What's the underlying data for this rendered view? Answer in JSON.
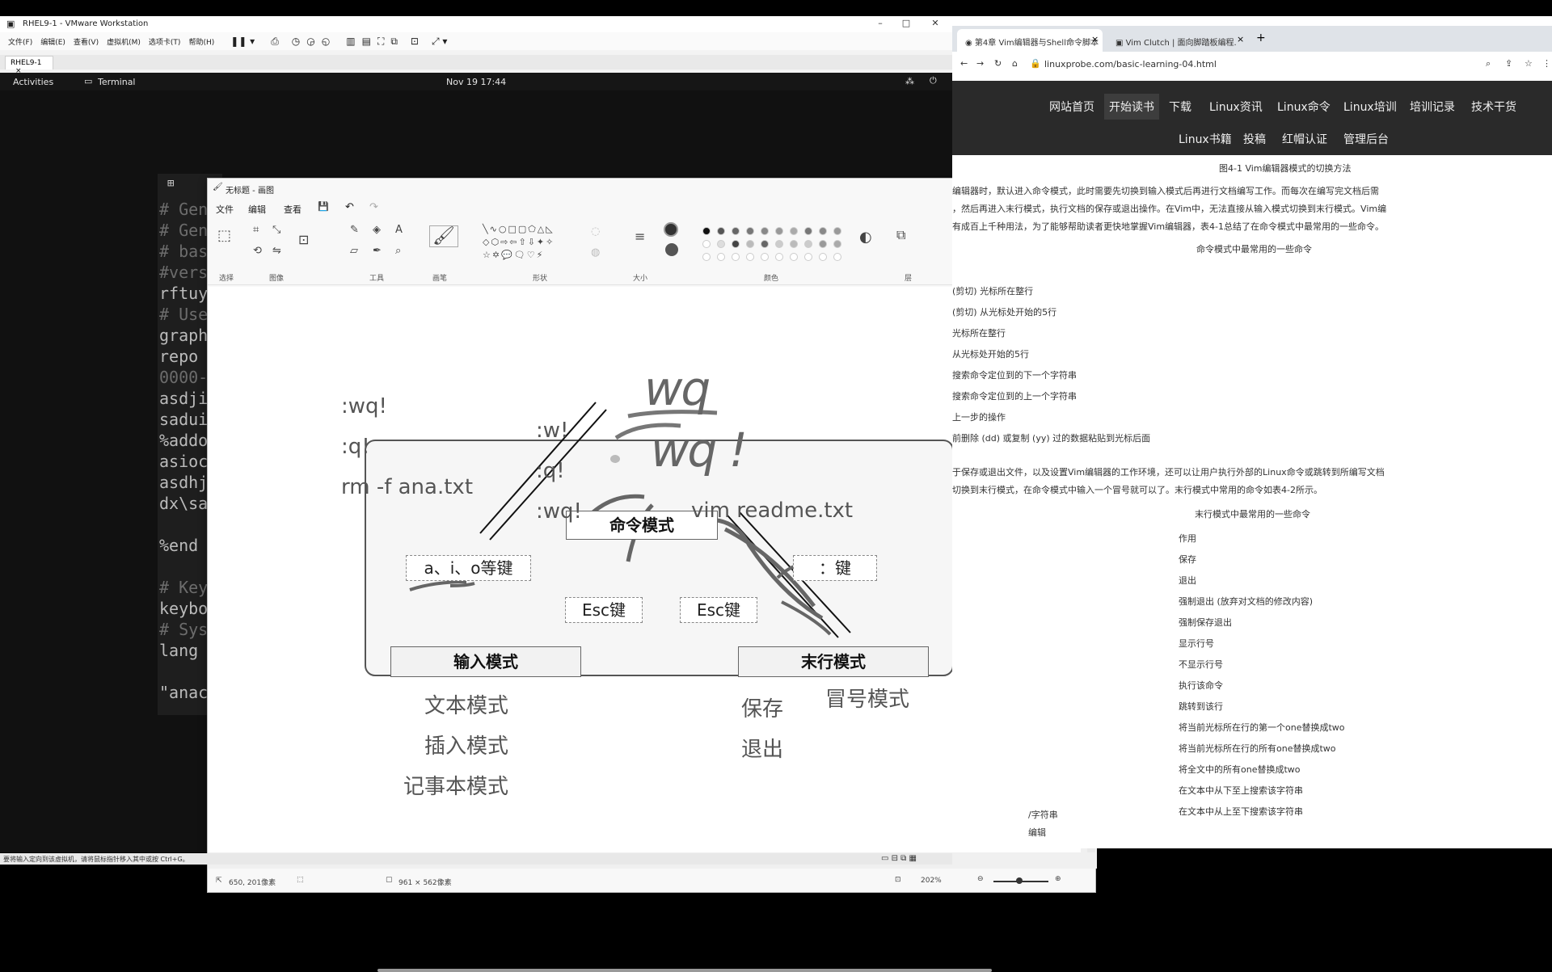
{
  "vmware": {
    "title": "RHEL9-1 - VMware Workstation",
    "menus": [
      "文件(F)",
      "编辑(E)",
      "查看(V)",
      "虚拟机(M)",
      "选项卡(T)",
      "帮助(H)"
    ],
    "tab": "RHEL9-1",
    "status_text": "要将输入定向到该虚拟机，请将鼠标指针移入其中或按 Ctrl+G。"
  },
  "gnome": {
    "activities": "Activities",
    "app": "Terminal",
    "clock": "Nov 19  17:44"
  },
  "terminal": {
    "lines": [
      "# Gen",
      "# Gen",
      "# bas",
      "#vers",
      "rftuy",
      "# Use",
      "graph",
      "repo",
      "0000-",
      "asdji",
      "sadui",
      "%addo",
      "asioc",
      "asdhj",
      "dx\\sa",
      "",
      "%end",
      "",
      "# Key",
      "keybo",
      "# Sys",
      "lang",
      "",
      "\"anac"
    ]
  },
  "paint": {
    "title": "无标题 - 画图",
    "menus": [
      "文件",
      "编辑",
      "查看"
    ],
    "groups": [
      "选择",
      "图像",
      "工具",
      "画笔",
      "形状",
      "大小",
      "颜色",
      "层"
    ],
    "status_pos": "650, 201像素",
    "status_size": "961 × 562像素",
    "zoom": "202%",
    "diagram": {
      "command_mode": "命令模式",
      "input_mode": "输入模式",
      "lastline_mode": "末行模式",
      "aio_keys": "a、i、o等键",
      "colon_key": "：键",
      "esc1": "Esc键",
      "esc2": "Esc键"
    },
    "notes": {
      "wq_bang": ":wq!",
      "q_bang": ":q!",
      "rm": "rm -f ana.txt",
      "w_bang": ":w!",
      "q_bang2": ":q!",
      "wq_bang2": ":wq!",
      "vim": "vim readme.txt",
      "hand_wq": "wq",
      "hand_wq_bang": "wq !",
      "text_mode": "文本模式",
      "insert_mode": "插入模式",
      "notepad_mode": "记事本模式",
      "save": "保存",
      "quit": "退出",
      "colon_mode": "冒号模式"
    }
  },
  "browser": {
    "tabs": [
      "第4章 Vim编辑器与Shell命令脚本",
      "Vim Clutch | 面向脚踏板编程..."
    ],
    "url": "linuxprobe.com/basic-learning-04.html",
    "nav1": [
      "网站首页",
      "开始读书",
      "下载",
      "Linux资讯",
      "Linux命令",
      "Linux培训",
      "培训记录",
      "技术干货"
    ],
    "nav2": [
      "Linux书籍",
      "投稿",
      "红帽认证",
      "管理后台"
    ],
    "figure_caption": "图4-1  Vim编辑器模式的切换方法",
    "para1": [
      "编辑器时，默认进入命令模式，此时需要先切换到输入模式后再进行文档编写工作。而每次在编写完文档后需",
      "，然后再进入末行模式，执行文档的保存或退出操作。在Vim中，无法直接从输入模式切换到末行模式。Vim编",
      "有成百上千种用法，为了能够帮助读者更快地掌握Vim编辑器，表4-1总结了在命令模式中最常用的一些命令。"
    ],
    "table1_title": "命令模式中最常用的一些命令",
    "table1_rows": [
      "(剪切) 光标所在整行",
      "(剪切) 从光标处开始的5行",
      "光标所在整行",
      "从光标处开始的5行",
      "搜索命令定位到的下一个字符串",
      "搜索命令定位到的上一个字符串",
      "上一步的操作",
      "前删除 (dd) 或复制 (yy) 过的数据粘贴到光标后面"
    ],
    "para2": [
      "于保存或退出文件，以及设置Vim编辑器的工作环境，还可以让用户执行外部的Linux命令或跳转到所编写文档",
      "切换到末行模式，在命令模式中输入一个冒号就可以了。末行模式中常用的命令如表4-2所示。"
    ],
    "table2_title": "末行模式中最常用的一些命令",
    "table2_rows": [
      "作用",
      "保存",
      "退出",
      "强制退出 (放弃对文档的修改内容)",
      "强制保存退出",
      "显示行号",
      "不显示行号",
      "执行该命令",
      "跳转到该行",
      "将当前光标所在行的第一个one替换成two",
      "将当前光标所在行的所有one替换成two",
      "将全文中的所有one替换成two",
      "在文本中从下至上搜索该字符串",
      "在文本中从上至下搜索该字符串"
    ],
    "bottom": [
      "/字符串",
      "编辑"
    ]
  }
}
